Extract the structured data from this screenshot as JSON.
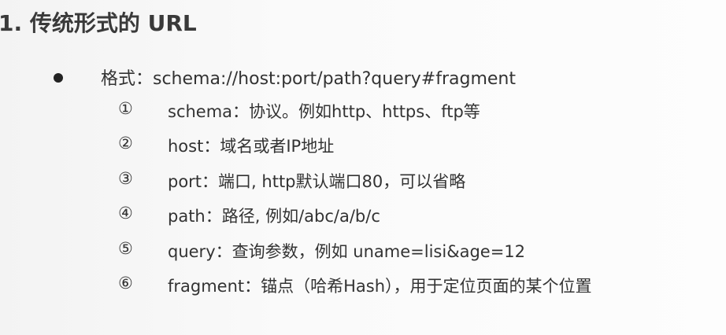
{
  "title": "1. 传统形式的 URL",
  "format": "格式：schema://host:port/path?query#fragment",
  "items": [
    {
      "num": "①",
      "text": "schema：协议。例如http、https、ftp等"
    },
    {
      "num": "②",
      "text": "host：域名或者IP地址"
    },
    {
      "num": "③",
      "text": "port：端口, http默认端口80，可以省略"
    },
    {
      "num": "④",
      "text": "path：路径, 例如/abc/a/b/c"
    },
    {
      "num": "⑤",
      "text": "query：查询参数，例如 uname=lisi&age=12"
    },
    {
      "num": "⑥",
      "text": "fragment：锚点（哈希Hash），用于定位页面的某个位置"
    }
  ]
}
